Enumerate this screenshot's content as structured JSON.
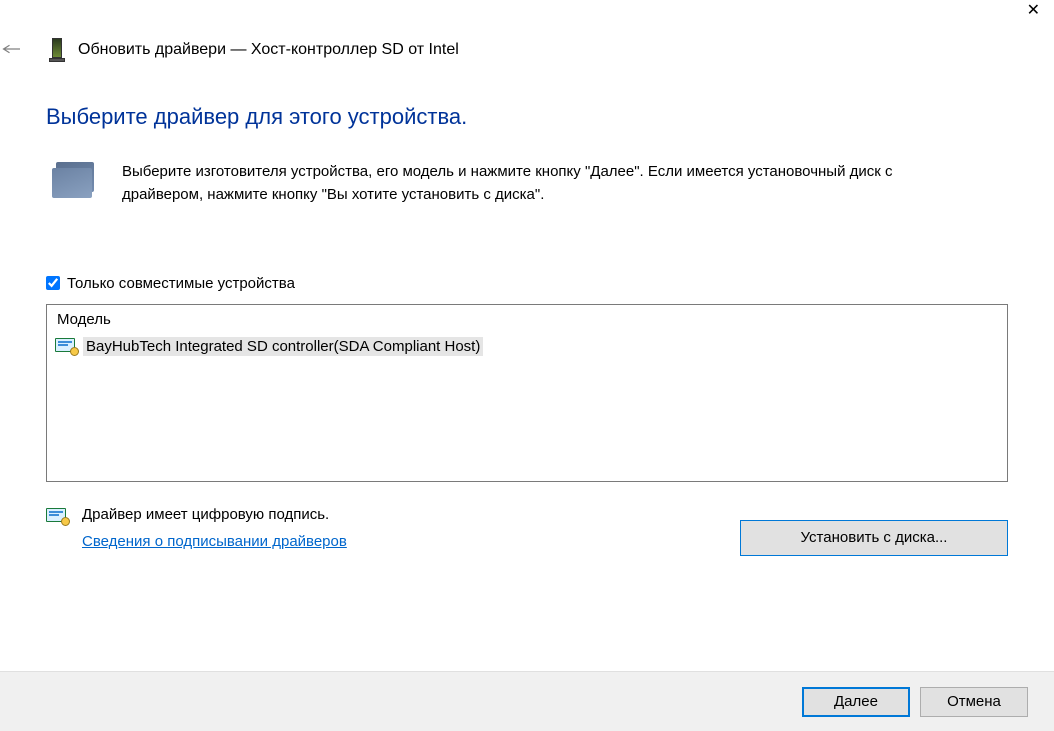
{
  "window": {
    "title": "Обновить драйвери — Хост-контроллер SD от Intel"
  },
  "heading": "Выберите драйвер для этого устройства.",
  "instruction": "Выберите изготовителя устройства, его модель и нажмите кнопку \"Далее\". Если имеется установочный диск с  драйвером, нажмите кнопку \"Вы хотите установить с диска\".",
  "compatible_checkbox": {
    "label": "Только совместимые устройства",
    "checked": true
  },
  "model_list": {
    "header": "Модель",
    "items": [
      {
        "label": "BayHubTech Integrated SD controller(SDA Compliant Host)",
        "selected": true
      }
    ]
  },
  "signature": {
    "text": "Драйвер имеет цифровую подпись.",
    "link": "Сведения о подписывании драйверов"
  },
  "buttons": {
    "install_from_disk": "Установить с диска...",
    "next": "Далее",
    "cancel": "Отмена"
  }
}
